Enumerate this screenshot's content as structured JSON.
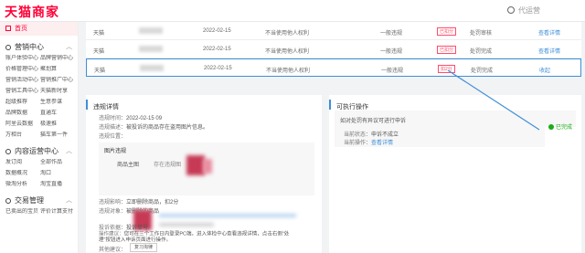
{
  "header": {
    "logo": "天猫商家",
    "search_placeholder": "代运营"
  },
  "sidebar": {
    "home": "首页",
    "sections": [
      {
        "title": "营销中心",
        "items": [
          "账户体验中心",
          "品牌营销中心",
          "价格管理中心",
          "聚划算",
          "营销活动中心",
          "营销推广中心",
          "营销工具中心",
          "天猫新时享",
          "超级推荐",
          "生意参谋",
          "品牌数据",
          "直通车",
          "阿里云数据",
          "极速推",
          "万相台",
          "猫车第一件"
        ]
      },
      {
        "title": "内容运营中心",
        "items": [
          "发订阅",
          "全部作品",
          "数据概况",
          "淘口",
          "微淘分析",
          "淘宝直播"
        ]
      },
      {
        "title": "交易管理",
        "items": [
          "已卖出的宝贝",
          "评价计算支付"
        ]
      }
    ]
  },
  "table": {
    "rows": [
      {
        "shop": "天猫",
        "date": "2022-02-15",
        "reason": "不当使用他人权利",
        "level": "一般违规",
        "tag": "已扣分",
        "status": "处罚审核",
        "action": "查看详情"
      },
      {
        "shop": "天猫",
        "date": "2022-02-15",
        "reason": "不当使用他人权利",
        "level": "一般违规",
        "tag": "已扣分",
        "status": "处罚完成",
        "action": "查看详情"
      },
      {
        "shop": "天猫",
        "date": "2022-02-15",
        "reason": "不当使用他人权利",
        "level": "一般违规",
        "tag": "扣2分",
        "status": "处罚完成",
        "action": "收起"
      }
    ]
  },
  "detail": {
    "title": "违规详情",
    "time_label": "违规时间：",
    "time_value": "2022-02-15 09",
    "desc_label": "违规描述：",
    "desc_value": "被投诉的商品存在盗用图片信息。",
    "location_label": "违规位置：",
    "evidence_title": "图片违规",
    "evidence_col": "商品主图",
    "evidence_desc": "存在违规图",
    "impact_label": "违规影响：",
    "impact_value": "立即删除商品，扣2分",
    "target_label": "违规对象：",
    "target_value": "被删除的商品",
    "source_label": "投诉依据：",
    "source_value": "投诉单号:",
    "advice_label": "操作建议：",
    "advice_value": "您可在三个工作日内登录PC端，进入体检中心查看违规详情，点击右侧“处理”按钮进入申诉页面进行操作。",
    "other_label": "其他建议：",
    "other_button": "复习淘律"
  },
  "ops": {
    "title": "可执行操作",
    "question": "如对处罚有异议可进行申诉",
    "state_label": "当前状态：",
    "state_value": "申诉不成立",
    "op_label": "当前操作：",
    "op_value": "查看详情",
    "done": "已完成"
  }
}
